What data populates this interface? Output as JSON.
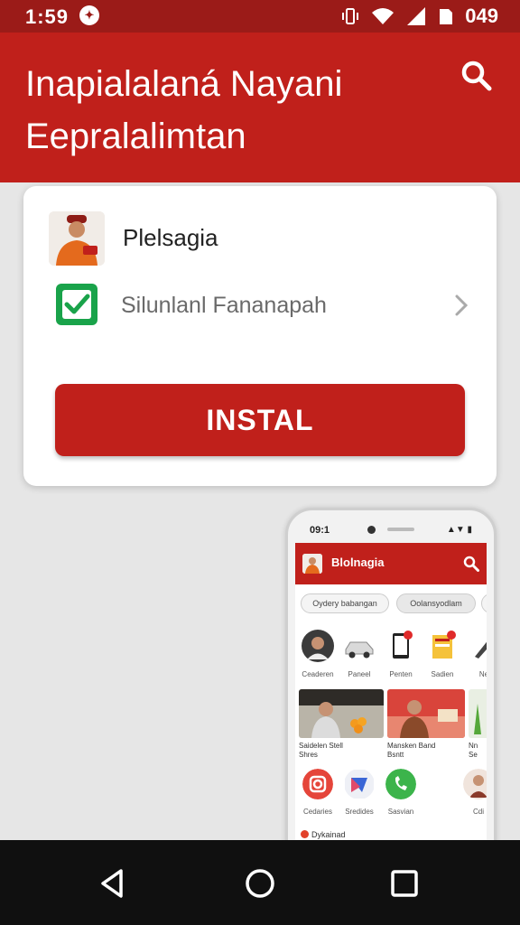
{
  "status_bar": {
    "time": "1:59",
    "app_icon": "swirl-notification-icon",
    "battery_text": "049",
    "icons": [
      "vibrate-icon",
      "wifi-icon",
      "cellular-signal-icon",
      "sim-icon"
    ]
  },
  "header": {
    "title": "Inapialalaná Nayani Eepralalimtan",
    "search_icon": "search-icon"
  },
  "install_card": {
    "app_name": "Plelsagia",
    "permission_label": "Silunlanl Fananapah",
    "install_label": "INSTAL"
  },
  "phone_preview": {
    "time": "09:1",
    "signal": "▲▼ ▮",
    "app_title": "Blolnagia",
    "chips": [
      "Oydery babangan",
      "Oolansyodlam",
      "S"
    ],
    "categories": [
      {
        "label": "Ceaderen",
        "icon": "person-icon"
      },
      {
        "label": "Paneel",
        "icon": "car-icon"
      },
      {
        "label": "Penten",
        "icon": "tablet-icon"
      },
      {
        "label": "Sadien",
        "icon": "notes-icon"
      },
      {
        "label": "Ne",
        "icon": "pen-icon"
      }
    ],
    "videos": [
      {
        "caption_line1": "Saidelen Stell",
        "caption_line2": "Shres"
      },
      {
        "caption_line1": "Mansken Band",
        "caption_line2": "Bsntt"
      },
      {
        "caption_line1": "Nn",
        "caption_line2": "Se"
      }
    ],
    "apps": [
      {
        "label": "Cedaries",
        "icon": "camera-app-icon"
      },
      {
        "label": "Sredides",
        "icon": "gallery-app-icon"
      },
      {
        "label": "Sasvian",
        "icon": "phone-app-icon"
      },
      {
        "label": "Cdi",
        "icon": "profile-app-icon"
      }
    ],
    "footer_label": "Dykainad"
  },
  "nav_bar": {
    "back": "back-icon",
    "home": "home-icon",
    "recents": "recents-icon"
  },
  "colors": {
    "primary_red": "#c0201b",
    "status_red": "#9b1b18",
    "check_green": "#19a34a"
  }
}
